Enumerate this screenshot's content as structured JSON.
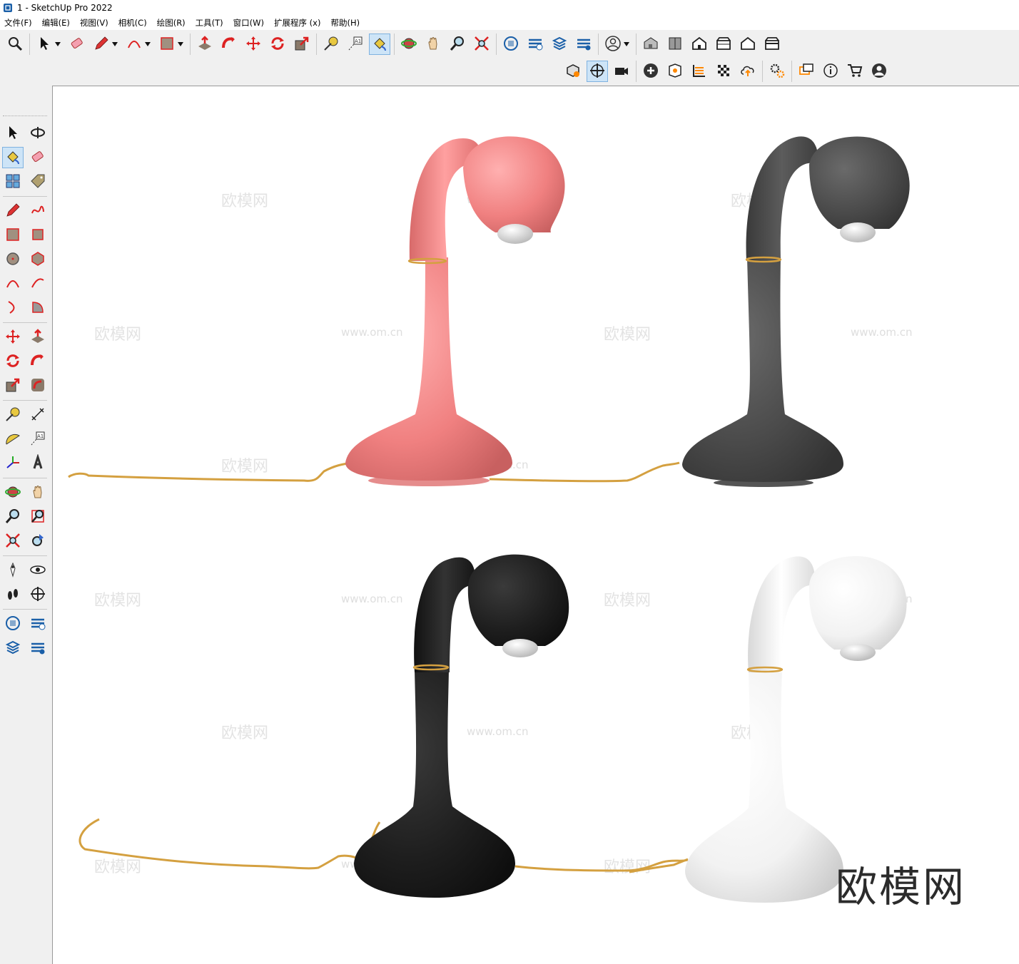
{
  "window": {
    "title": "1 - SketchUp Pro 2022"
  },
  "menu": [
    "文件(F)",
    "编辑(E)",
    "视图(V)",
    "相机(C)",
    "绘图(R)",
    "工具(T)",
    "窗口(W)",
    "扩展程序 (x)",
    "帮助(H)"
  ],
  "colors": {
    "lamp_pink": "#f08080",
    "lamp_dark_gray": "#4a4a4a",
    "lamp_black": "#1e1e1e",
    "lamp_white": "#f2f2f2",
    "cord": "#d4a040",
    "accent_red": "#d22",
    "selected_tool_bg": "#cde4f7"
  },
  "watermark": {
    "brand": "欧模网",
    "url": "www.om.cn"
  },
  "toolbar_main": {
    "groups": [
      [
        "search-icon"
      ],
      [
        "select-arrow-icon",
        "eraser-icon",
        "pencil-icon",
        "arc-icon",
        "rectangle-icon"
      ],
      [
        "push-pull-icon",
        "follow-me-icon",
        "move-icon",
        "rotate-icon",
        "scale-icon"
      ],
      [
        "tape-measure-icon",
        "text-label-icon",
        "paint-bucket-icon"
      ],
      [
        "orbit-icon",
        "pan-hand-icon",
        "zoom-icon",
        "zoom-extents-icon"
      ],
      [
        "3d-warehouse-icon",
        "extension-warehouse-icon",
        "layout-icon",
        "extension-manager-icon"
      ],
      [
        "user-account-icon"
      ],
      [
        "iso-view-icon",
        "top-view-icon",
        "front-view-icon",
        "right-view-icon",
        "back-view-icon",
        "left-view-icon"
      ]
    ]
  },
  "toolbar_second": {
    "icons": [
      "solid-inspector-icon",
      "section-plane-icon",
      "camera-icon",
      "add-location-icon",
      "sandbox-icon",
      "styles-icon",
      "checker-icon",
      "upload-icon",
      "settings-gears-icon",
      "comment-icon",
      "info-icon",
      "cart-icon",
      "profile-icon"
    ]
  },
  "left_toolbar": {
    "rows": [
      [
        "select-icon",
        "orbit-rotate-icon"
      ],
      [
        "paint-bucket-icon",
        "eraser-icon"
      ],
      [
        "make-component-icon",
        "tag-icon"
      ],
      "sep",
      [
        "line-icon",
        "freehand-icon"
      ],
      [
        "rectangle-icon",
        "rotated-rectangle-icon"
      ],
      [
        "circle-icon",
        "polygon-icon"
      ],
      [
        "arc-icon",
        "two-point-arc-icon"
      ],
      [
        "three-point-arc-icon",
        "pie-icon"
      ],
      "sep",
      [
        "move-icon",
        "push-pull-icon"
      ],
      [
        "rotate-icon",
        "follow-me-icon"
      ],
      [
        "scale-icon",
        "offset-icon"
      ],
      "sep",
      [
        "tape-measure-icon",
        "dimension-icon"
      ],
      [
        "protractor-icon",
        "text-icon"
      ],
      [
        "axes-icon",
        "3d-text-icon"
      ],
      "sep",
      [
        "orbit-icon",
        "pan-icon"
      ],
      [
        "zoom-icon",
        "zoom-window-icon"
      ],
      [
        "zoom-extents-icon",
        "previous-view-icon"
      ],
      "sep",
      [
        "position-camera-icon",
        "look-around-icon"
      ],
      [
        "walk-icon",
        "section-plane-icon"
      ],
      "sep",
      [
        "3d-warehouse-icon",
        "extension-warehouse-icon"
      ],
      [
        "layout-send-icon",
        "extension-manager-icon"
      ]
    ]
  }
}
